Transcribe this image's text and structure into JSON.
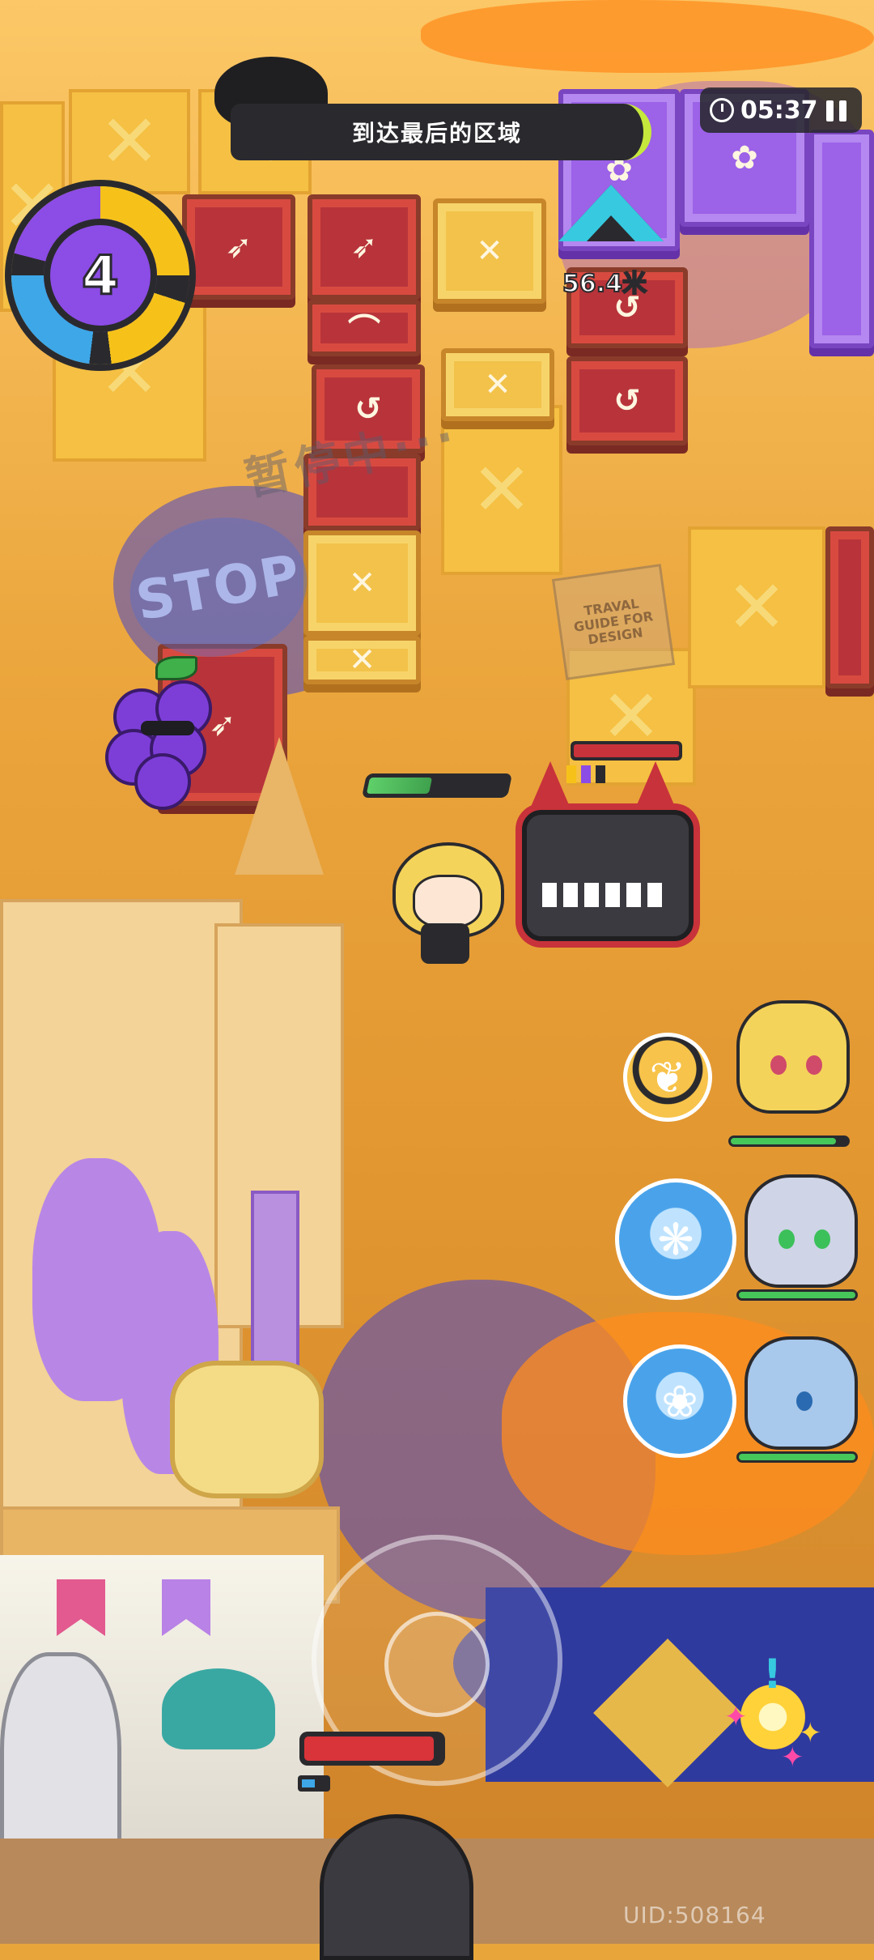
{
  "hud": {
    "objective": "到达最后的区域",
    "timer": "05:37",
    "ink_level": "4",
    "distance": "56.4米",
    "uid": "UID:508164"
  },
  "overlay": {
    "paused_text": "暂停中···",
    "stop_text": "STOP",
    "guide_text": "TRAVAL GUIDE FOR DESIGN"
  },
  "icons": {
    "pause": "pause-icon",
    "clock": "clock-icon",
    "direction": "arrow-up-icon",
    "ultimate": "star-burst-icon"
  },
  "party": [
    {
      "name": "member-1",
      "skill": "flame",
      "hp": 0.9
    },
    {
      "name": "member-2",
      "skill": "feather",
      "hp": 1.0
    },
    {
      "name": "member-3",
      "skill": "flower",
      "hp": 1.0
    }
  ],
  "bars": {
    "player_hp": 0.45,
    "boss_hp": 1.0,
    "ink_tank": 0.95
  },
  "colors": {
    "accent_lime": "#c6e83c",
    "ink_purple": "#8c4ce6",
    "ink_blue": "#3da7e8",
    "ink_yellow": "#f6c21a",
    "boss_red": "#c8323a"
  }
}
